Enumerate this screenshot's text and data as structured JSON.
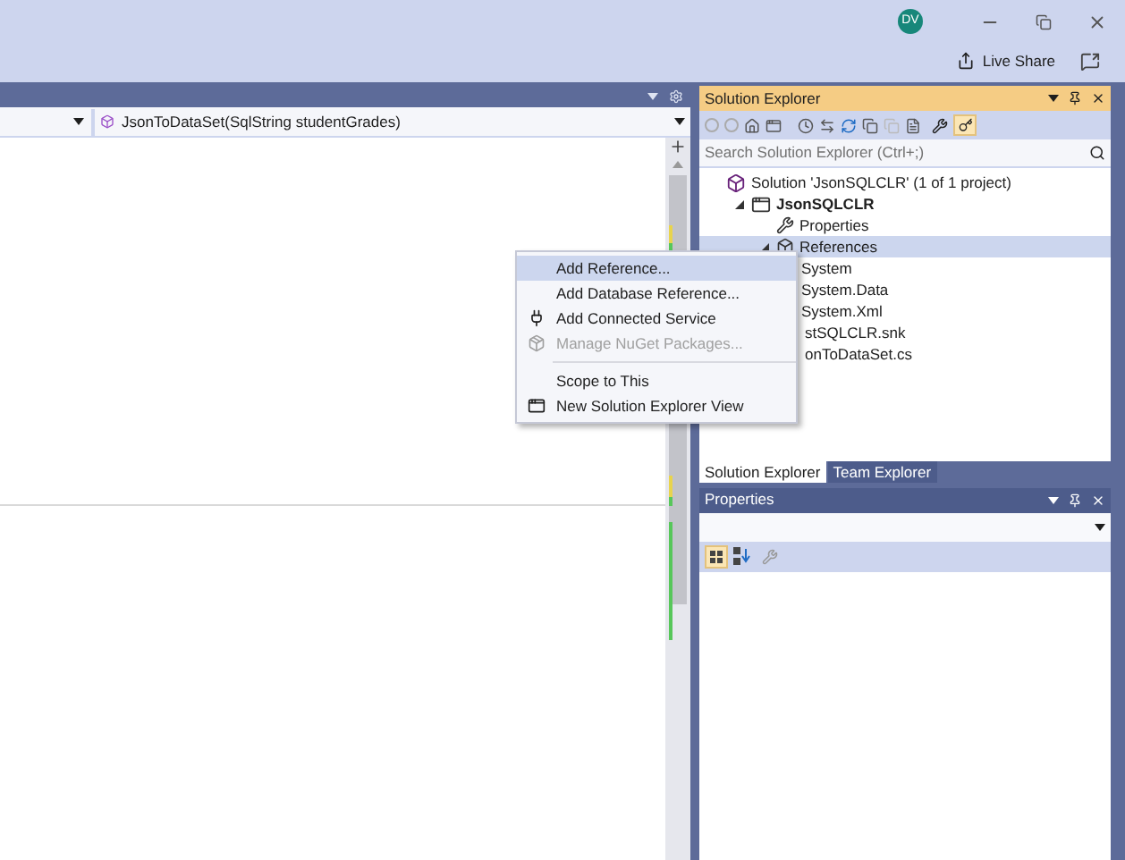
{
  "title_bar": {
    "avatar": "DV",
    "live_share": "Live Share"
  },
  "editor": {
    "method_dropdown": "JsonToDataSet(SqlString studentGrades)"
  },
  "solution_explorer": {
    "title": "Solution Explorer",
    "search": {
      "placeholder": "Search Solution Explorer (Ctrl+;)"
    },
    "tree": [
      {
        "label": "Solution 'JsonSQLCLR' (1 of 1 project)",
        "kind": "solution",
        "selected": false,
        "children": [
          {
            "label": "JsonSQLCLR",
            "kind": "project",
            "expanded": true,
            "selected": false,
            "children": [
              {
                "label": "Properties",
                "kind": "properties",
                "selected": false
              },
              {
                "label": "References",
                "kind": "references",
                "expanded": true,
                "selected": true,
                "children": [
                  {
                    "label": "System",
                    "selected": false
                  },
                  {
                    "label": "System.Data",
                    "selected": false
                  },
                  {
                    "label": "System.Xml",
                    "selected": false
                  }
                ]
              },
              {
                "label": "stSQLCLR.snk",
                "kind": "file",
                "selected": false
              },
              {
                "label": "onToDataSet.cs",
                "kind": "file",
                "selected": false
              }
            ]
          }
        ]
      }
    ],
    "tabs": [
      {
        "label": "Solution Explorer",
        "selected": true
      },
      {
        "label": "Team Explorer",
        "selected": false
      }
    ]
  },
  "context_menu": [
    {
      "label": "Add Reference...",
      "kind": "item",
      "selected": true,
      "disabled": false
    },
    {
      "label": "Add Database Reference...",
      "kind": "item",
      "selected": false,
      "disabled": false
    },
    {
      "label": "Add Connected Service",
      "kind": "service",
      "selected": false,
      "disabled": false
    },
    {
      "label": "Manage NuGet Packages...",
      "kind": "nuget",
      "selected": false,
      "disabled": true
    },
    {
      "kind": "separator"
    },
    {
      "label": "Scope to This",
      "kind": "item",
      "selected": false,
      "disabled": false
    },
    {
      "label": "New Solution Explorer View",
      "kind": "view",
      "selected": false,
      "disabled": false
    }
  ],
  "properties": {
    "title": "Properties"
  }
}
